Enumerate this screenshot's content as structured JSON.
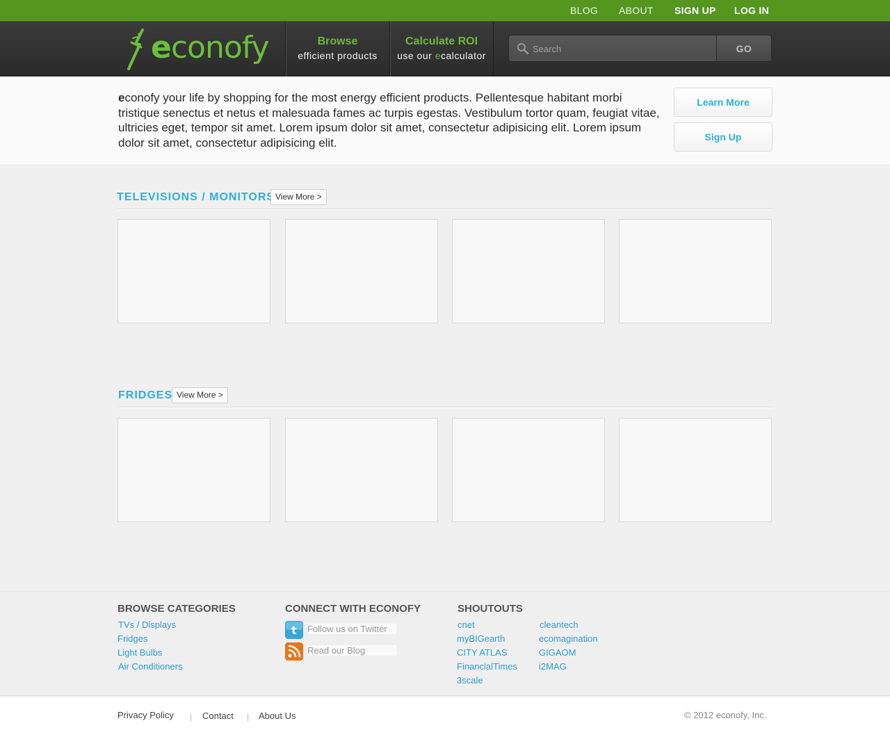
{
  "topbar": {
    "blog": "BLOG",
    "about": "ABOUT",
    "sign_up": "SIGN UP",
    "log_in": "LOG IN"
  },
  "header": {
    "logo_first": "e",
    "logo_rest": "conofy",
    "nav": [
      {
        "title": "Browse",
        "subtitle": "efficient products"
      },
      {
        "title": "Calculate ROI",
        "subtitle_pre": "use our ",
        "subtitle_accent": "e",
        "subtitle_post": "calculator"
      }
    ],
    "search": {
      "placeholder": "Search",
      "button": "GO"
    }
  },
  "intro": {
    "lead": "e",
    "text": "conofy your life by shopping for the most energy efficient products. Pellentesque habitant morbi tristique senectus et netus et malesuada fames ac turpis egestas. Vestibulum tortor quam, feugiat vitae, ultricies eget, tempor sit amet. Lorem ipsum dolor sit amet, consectetur adipisicing elit. Lorem ipsum dolor sit amet, consectetur adipisicing elit.",
    "learn_more": "Learn More",
    "sign_up": "Sign Up"
  },
  "sections": [
    {
      "title": "TELEVISIONS / MONITORS",
      "view_more": "View More >"
    },
    {
      "title": "FRIDGES",
      "view_more": "View More >"
    }
  ],
  "footer": {
    "browse": {
      "heading": "BROWSE CATEGORIES",
      "links": [
        "TVs / Displays",
        "Fridges",
        "Light Bulbs",
        "Air Conditioners"
      ]
    },
    "connect": {
      "heading": "CONNECT WITH ECONOFY",
      "twitter": "Follow us on Twitter",
      "blog": "Read our Blog"
    },
    "shoutouts": {
      "heading": "SHOUTOUTS",
      "col1": [
        "cnet",
        "myBIGearth",
        "CITY ATLAS",
        "FinancialTimes",
        "3scale"
      ],
      "col2": [
        "cleantech",
        "ecomagination",
        "GIGAOM",
        "i2MAG"
      ]
    }
  },
  "bottom": {
    "links": [
      "Privacy Policy",
      "Contact",
      "About Us"
    ],
    "separator": "|",
    "copyright": "© 2012 econofy, Inc."
  },
  "colors": {
    "brand_green": "#55961f",
    "logo_green": "#6bbf3a",
    "link_blue": "#2bb0e3",
    "header_dark": "#333333"
  }
}
